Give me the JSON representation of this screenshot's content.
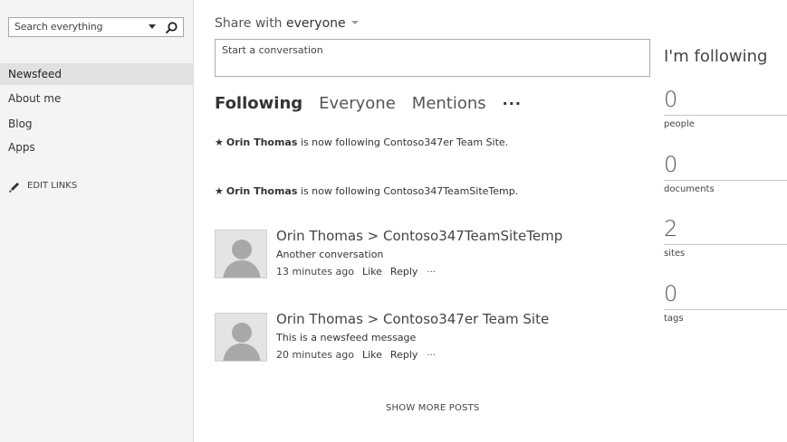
{
  "search": {
    "placeholder": "Search everything"
  },
  "sidebar": {
    "items": [
      {
        "label": "Newsfeed",
        "selected": true
      },
      {
        "label": "About me"
      },
      {
        "label": "Blog"
      },
      {
        "label": "Apps"
      }
    ],
    "edit_links": "EDIT LINKS"
  },
  "share": {
    "prefix": "Share with ",
    "audience": "everyone"
  },
  "conversation": {
    "placeholder": "Start a conversation"
  },
  "tabs": {
    "following": "Following",
    "everyone": "Everyone",
    "mentions": "Mentions",
    "more": "···"
  },
  "activities": [
    {
      "user": "Orin Thomas",
      "text": " is now following Contoso347er Team Site."
    },
    {
      "user": "Orin Thomas",
      "text": " is now following Contoso347TeamSiteTemp."
    }
  ],
  "posts": [
    {
      "title": "Orin Thomas > Contoso347TeamSiteTemp",
      "message": "Another conversation",
      "time": "13 minutes ago",
      "like": "Like",
      "reply": "Reply",
      "more": "···"
    },
    {
      "title": "Orin Thomas > Contoso347er Team Site",
      "message": "This is a newsfeed message",
      "time": "20 minutes ago",
      "like": "Like",
      "reply": "Reply",
      "more": "···"
    }
  ],
  "show_more": "SHOW MORE POSTS",
  "following_panel": {
    "title": "I'm following",
    "stats": [
      {
        "count": "0",
        "label": "people"
      },
      {
        "count": "0",
        "label": "documents"
      },
      {
        "count": "2",
        "label": "sites"
      },
      {
        "count": "0",
        "label": "tags"
      }
    ]
  },
  "icons": {
    "search": "search-icon",
    "edit": "pencil-icon",
    "dropdown": "chevron-down-icon",
    "star": "star-icon",
    "avatar": "person-silhouette"
  },
  "colors": {
    "sidebar_bg": "#f4f4f4",
    "selected_bg": "#e1e1e1",
    "text": "#333333"
  }
}
